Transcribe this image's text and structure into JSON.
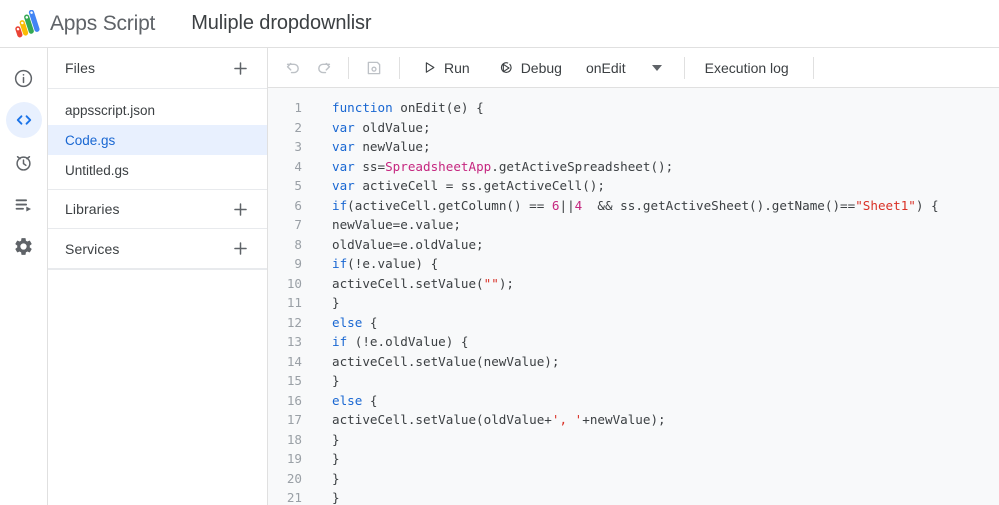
{
  "header": {
    "brand_name": "Apps Script",
    "brand_logo_icon": "apps-script-logo",
    "doc_title": "Muliple dropdownlisr"
  },
  "nav_rail": {
    "items": [
      {
        "id": "overview",
        "icon": "info-icon",
        "active": false
      },
      {
        "id": "editor",
        "icon": "code-icon",
        "active": true
      },
      {
        "id": "triggers",
        "icon": "alarm-clock-icon",
        "active": false
      },
      {
        "id": "executions",
        "icon": "executions-icon",
        "active": false
      },
      {
        "id": "settings",
        "icon": "gear-icon",
        "active": false
      }
    ]
  },
  "files_panel": {
    "files_section": {
      "title": "Files",
      "add_icon": "plus-icon",
      "items": [
        {
          "name": "appsscript.json",
          "selected": false
        },
        {
          "name": "Code.gs",
          "selected": true
        },
        {
          "name": "Untitled.gs",
          "selected": false
        }
      ]
    },
    "libraries_section": {
      "title": "Libraries",
      "add_icon": "plus-icon"
    },
    "services_section": {
      "title": "Services",
      "add_icon": "plus-icon"
    }
  },
  "toolbar": {
    "undo_icon": "undo-icon",
    "redo_icon": "redo-icon",
    "save_icon": "save-icon",
    "run_label": "Run",
    "run_icon": "play-icon",
    "debug_label": "Debug",
    "debug_icon": "debug-icon",
    "function_selected": "onEdit",
    "function_caret_icon": "chevron-down-icon",
    "execution_log_label": "Execution log"
  },
  "colors": {
    "accent_blue": "#1a73e8",
    "selected_bg": "#e8f0fe",
    "keyword": "#1967d2",
    "class": "#c5267f",
    "number": "#c5267f",
    "string": "#d93025",
    "editor_bg": "#f8f9fa",
    "gutter_text": "#9aa0a6",
    "code_text": "#3c4043"
  },
  "code": {
    "language": "javascript",
    "file": "Code.gs",
    "lines": [
      {
        "n": 1,
        "tokens": [
          {
            "t": "function",
            "c": "kw"
          },
          {
            "t": " onEdit(e) {",
            "c": ""
          }
        ]
      },
      {
        "n": 2,
        "tokens": [
          {
            "t": "var",
            "c": "kw"
          },
          {
            "t": " oldValue;",
            "c": ""
          }
        ]
      },
      {
        "n": 3,
        "tokens": [
          {
            "t": "var",
            "c": "kw"
          },
          {
            "t": " newValue;",
            "c": ""
          }
        ]
      },
      {
        "n": 4,
        "tokens": [
          {
            "t": "var",
            "c": "kw"
          },
          {
            "t": " ss=",
            "c": ""
          },
          {
            "t": "SpreadsheetApp",
            "c": "cls"
          },
          {
            "t": ".getActiveSpreadsheet();",
            "c": ""
          }
        ]
      },
      {
        "n": 5,
        "tokens": [
          {
            "t": "var",
            "c": "kw"
          },
          {
            "t": " activeCell = ss.getActiveCell();",
            "c": ""
          }
        ]
      },
      {
        "n": 6,
        "tokens": [
          {
            "t": "if",
            "c": "kw"
          },
          {
            "t": "(activeCell.getColumn() == ",
            "c": ""
          },
          {
            "t": "6",
            "c": "num"
          },
          {
            "t": "||",
            "c": ""
          },
          {
            "t": "4",
            "c": "num"
          },
          {
            "t": "  && ss.getActiveSheet().getName()==",
            "c": ""
          },
          {
            "t": "\"Sheet1\"",
            "c": "str"
          },
          {
            "t": ") {",
            "c": ""
          }
        ]
      },
      {
        "n": 7,
        "tokens": [
          {
            "t": "newValue=e.value;",
            "c": ""
          }
        ]
      },
      {
        "n": 8,
        "tokens": [
          {
            "t": "oldValue=e.oldValue;",
            "c": ""
          }
        ]
      },
      {
        "n": 9,
        "tokens": [
          {
            "t": "if",
            "c": "kw"
          },
          {
            "t": "(!e.value) {",
            "c": ""
          }
        ]
      },
      {
        "n": 10,
        "tokens": [
          {
            "t": "activeCell.setValue(",
            "c": ""
          },
          {
            "t": "\"\"",
            "c": "str"
          },
          {
            "t": ");",
            "c": ""
          }
        ]
      },
      {
        "n": 11,
        "tokens": [
          {
            "t": "}",
            "c": ""
          }
        ]
      },
      {
        "n": 12,
        "tokens": [
          {
            "t": "else",
            "c": "kw"
          },
          {
            "t": " {",
            "c": ""
          }
        ]
      },
      {
        "n": 13,
        "tokens": [
          {
            "t": "if",
            "c": "kw"
          },
          {
            "t": " (!e.oldValue) {",
            "c": ""
          }
        ]
      },
      {
        "n": 14,
        "tokens": [
          {
            "t": "activeCell.setValue(newValue);",
            "c": ""
          }
        ]
      },
      {
        "n": 15,
        "tokens": [
          {
            "t": "}",
            "c": ""
          }
        ]
      },
      {
        "n": 16,
        "tokens": [
          {
            "t": "else",
            "c": "kw"
          },
          {
            "t": " {",
            "c": ""
          }
        ]
      },
      {
        "n": 17,
        "tokens": [
          {
            "t": "activeCell.setValue(oldValue+",
            "c": ""
          },
          {
            "t": "', '",
            "c": "str"
          },
          {
            "t": "+newValue);",
            "c": ""
          }
        ]
      },
      {
        "n": 18,
        "tokens": [
          {
            "t": "}",
            "c": ""
          }
        ]
      },
      {
        "n": 19,
        "tokens": [
          {
            "t": "}",
            "c": ""
          }
        ]
      },
      {
        "n": 20,
        "tokens": [
          {
            "t": "}",
            "c": ""
          }
        ]
      },
      {
        "n": 21,
        "tokens": [
          {
            "t": "}",
            "c": ""
          }
        ]
      }
    ]
  }
}
